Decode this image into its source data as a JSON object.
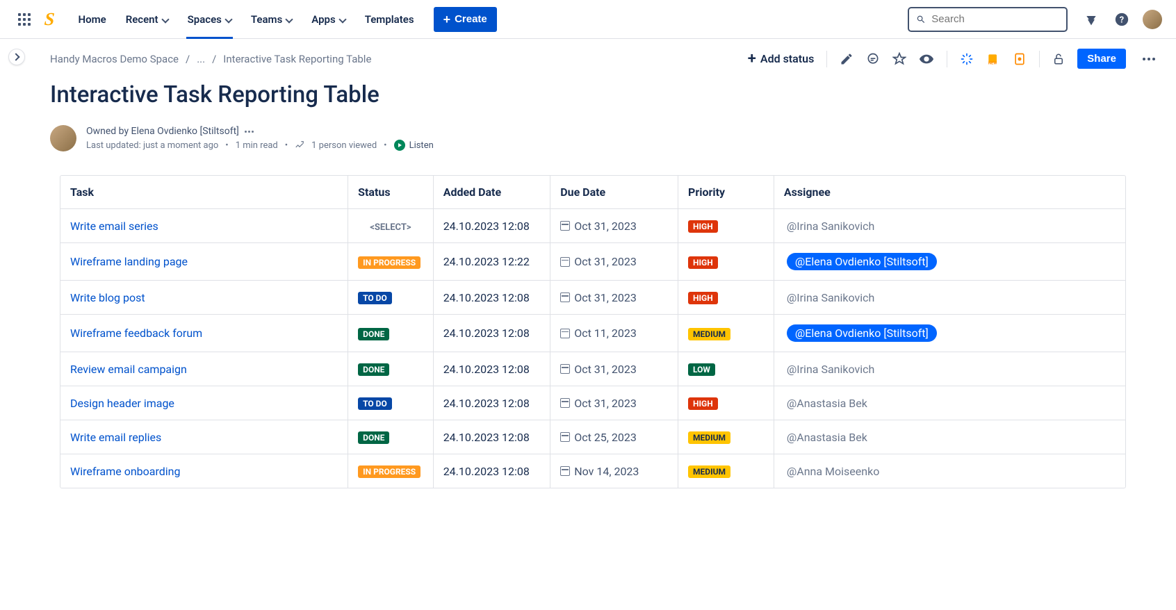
{
  "nav": {
    "home": "Home",
    "recent": "Recent",
    "spaces": "Spaces",
    "teams": "Teams",
    "apps": "Apps",
    "templates": "Templates",
    "create": "Create",
    "search_placeholder": "Search"
  },
  "breadcrumb": {
    "space": "Handy Macros Demo Space",
    "ellipsis": "...",
    "current": "Interactive Task Reporting Table"
  },
  "subhead": {
    "add_status": "Add status",
    "share": "Share"
  },
  "page": {
    "title": "Interactive Task Reporting Table",
    "owner_line": "Owned by Elena Ovdienko [Stiltsoft]",
    "last_updated": "Last updated: just a moment ago",
    "read_time": "1 min read",
    "views": "1 person viewed",
    "listen": "Listen"
  },
  "table": {
    "headers": {
      "task": "Task",
      "status": "Status",
      "added": "Added Date",
      "due": "Due Date",
      "priority": "Priority",
      "assignee": "Assignee"
    },
    "rows": [
      {
        "task": "Write email series",
        "status": "<SELECT>",
        "status_type": "select",
        "added": "24.10.2023 12:08",
        "due": "Oct 31, 2023",
        "priority": "HIGH",
        "priority_class": "loz-high",
        "assignee": "@Irina Sanikovich",
        "assignee_hl": false
      },
      {
        "task": "Wireframe landing page",
        "status": "IN PROGRESS",
        "status_type": "loz-inprogress",
        "added": "24.10.2023 12:22",
        "due": "Oct 31, 2023",
        "priority": "HIGH",
        "priority_class": "loz-high",
        "assignee": "@Elena Ovdienko [Stiltsoft]",
        "assignee_hl": true
      },
      {
        "task": "Write blog post",
        "status": "TO DO",
        "status_type": "loz-todo",
        "added": "24.10.2023 12:08",
        "due": "Oct 31, 2023",
        "priority": "HIGH",
        "priority_class": "loz-high",
        "assignee": "@Irina Sanikovich",
        "assignee_hl": false
      },
      {
        "task": "Wireframe feedback forum",
        "status": "DONE",
        "status_type": "loz-done",
        "added": "24.10.2023 12:08",
        "due": "Oct 11, 2023",
        "priority": "MEDIUM",
        "priority_class": "loz-medium",
        "assignee": "@Elena Ovdienko [Stiltsoft]",
        "assignee_hl": true
      },
      {
        "task": "Review email campaign",
        "status": "DONE",
        "status_type": "loz-done",
        "added": "24.10.2023 12:08",
        "due": "Oct 31, 2023",
        "priority": "LOW",
        "priority_class": "loz-low",
        "assignee": "@Irina Sanikovich",
        "assignee_hl": false
      },
      {
        "task": "Design header image",
        "status": "TO DO",
        "status_type": "loz-todo",
        "added": "24.10.2023 12:08",
        "due": "Oct 31, 2023",
        "priority": "HIGH",
        "priority_class": "loz-high",
        "assignee": "@Anastasia Bek",
        "assignee_hl": false
      },
      {
        "task": "Write email replies",
        "status": "DONE",
        "status_type": "loz-done",
        "added": "24.10.2023 12:08",
        "due": "Oct 25, 2023",
        "priority": "MEDIUM",
        "priority_class": "loz-medium",
        "assignee": "@Anastasia Bek",
        "assignee_hl": false
      },
      {
        "task": "Wireframe onboarding",
        "status": "IN PROGRESS",
        "status_type": "loz-inprogress",
        "added": "24.10.2023 12:08",
        "due": "Nov 14, 2023",
        "priority": "MEDIUM",
        "priority_class": "loz-medium",
        "assignee": "@Anna Moiseenko",
        "assignee_hl": false
      }
    ]
  }
}
